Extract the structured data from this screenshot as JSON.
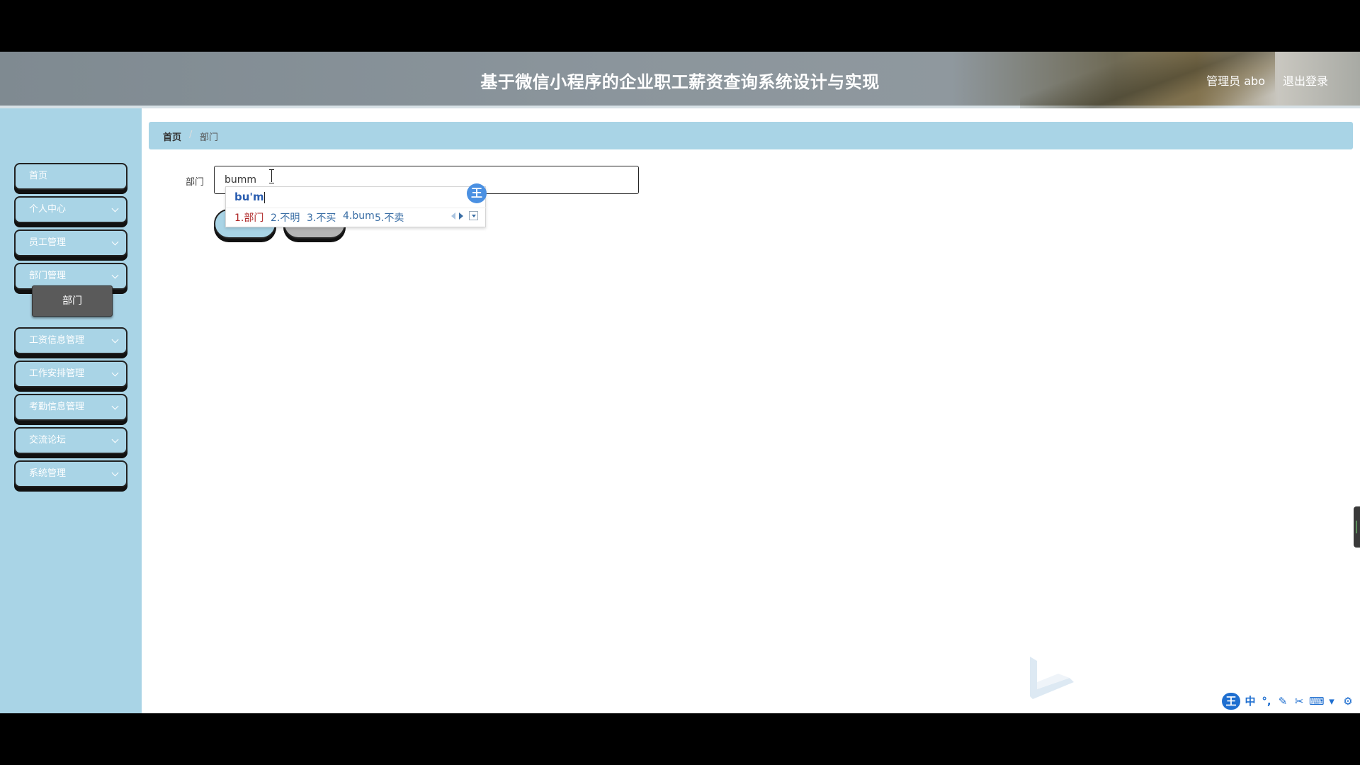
{
  "header": {
    "title": "基于微信小程序的企业职工薪资查询系统设计与实现",
    "admin_label": "管理员 abo",
    "logout_label": "退出登录"
  },
  "sidebar": {
    "items": [
      {
        "label": "首页"
      },
      {
        "label": "个人中心"
      },
      {
        "label": "员工管理"
      },
      {
        "label": "部门管理"
      },
      {
        "label": "工资信息管理"
      },
      {
        "label": "工作安排管理"
      },
      {
        "label": "考勤信息管理"
      },
      {
        "label": "交流论坛"
      },
      {
        "label": "系统管理"
      }
    ],
    "submenu_active": "部门"
  },
  "breadcrumb": {
    "home": "首页",
    "separator": "/",
    "current": "部门"
  },
  "form": {
    "field_label": "部门",
    "input_value": "bumm"
  },
  "ime": {
    "composition": "bu'm",
    "badge": "王",
    "candidates": [
      "1.部门",
      "2.不明",
      "3.不买",
      "4.bum",
      "5.不卖"
    ]
  },
  "tray": {
    "logo": "王",
    "mode": "中",
    "icons": [
      "punctuation-icon",
      "pen-icon",
      "scissors-icon",
      "keyboard-icon",
      "shirt-icon",
      "settings-gear-icon"
    ]
  },
  "colors": {
    "sidebar_bg": "#a9d4e6",
    "submenu_active_bg": "#5a5a5a",
    "ime_accent": "#4a90e2",
    "first_candidate": "#b02a2a"
  }
}
